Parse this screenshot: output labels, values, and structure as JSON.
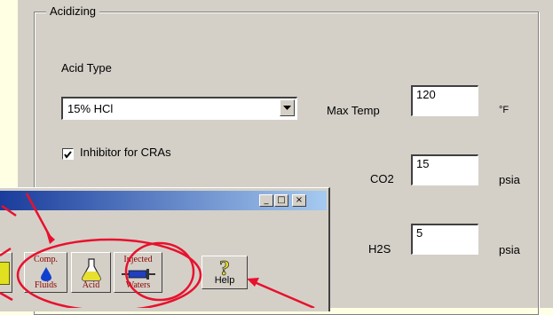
{
  "group": {
    "title": "Acidizing"
  },
  "acid_type": {
    "label": "Acid Type",
    "selected": "15% HCl"
  },
  "inhibitor": {
    "label": "Inhibitor for CRAs",
    "checked": true
  },
  "max_temp": {
    "label": "Max Temp",
    "value": "120",
    "unit": "°F"
  },
  "co2": {
    "label": "CO2",
    "value": "15",
    "unit": "psia"
  },
  "h2s": {
    "label": "H2S",
    "value": "5",
    "unit": "psia"
  },
  "mini_window": {
    "minimize": "_",
    "maximize": "□",
    "close": "×"
  },
  "toolbar": {
    "comp_fluids": {
      "top": "Comp.",
      "bottom": "Fluids"
    },
    "acid": {
      "bottom": "Acid"
    },
    "injected_waters": {
      "top": "Injected",
      "bottom": "Waters"
    },
    "help": {
      "label": "Help"
    }
  },
  "colors": {
    "annotation_red": "#e8112d",
    "panel_gray": "#d4d0c8",
    "title_blue": "#1a3c9c"
  }
}
